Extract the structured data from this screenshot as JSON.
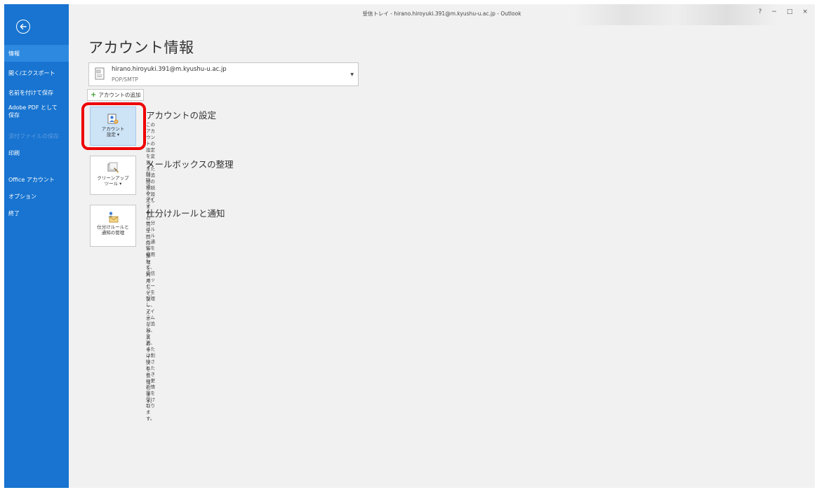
{
  "window": {
    "title": "受信トレイ - hirano.hiroyuki.391@m.kyushu-u.ac.jp - Outlook",
    "help": "?",
    "minimize": "−",
    "restore": "□",
    "close": "×"
  },
  "sidebar": {
    "back_icon": "back-arrow-icon",
    "items": [
      {
        "label": "情報"
      },
      {
        "label": "開く/エクスポート"
      },
      {
        "label": "名前を付けて保存"
      },
      {
        "label": "Adobe PDF として\n保存"
      },
      {
        "label": "添付ファイルの保存"
      },
      {
        "label": "印刷"
      },
      {
        "label": "Office アカウント"
      },
      {
        "label": "オプション"
      },
      {
        "label": "終了"
      }
    ],
    "colors": {
      "background": "#1874d0",
      "selected": "#2d89e0"
    }
  },
  "page": {
    "title": "アカウント情報"
  },
  "account": {
    "email": "hirano.hiroyuki.391@m.kyushu-u.ac.jp",
    "type": "POP/SMTP",
    "caret": "▼"
  },
  "add_account": {
    "label": "アカウントの追加"
  },
  "sections": [
    {
      "tile_label": "アカウント\n設定 ▾",
      "heading": "アカウントの設定",
      "description": "このアカウントの設定を変更、または追加の接続を設定します。"
    },
    {
      "tile_label": "クリーンアップ\nツール ▾",
      "heading": "メールボックスの整理",
      "description": "削除済みアイテムの完全削除や整理を利用して、メールボックスのサイズを管理します。"
    },
    {
      "tile_label": "仕分けルールと\n通知の管理",
      "heading": "仕分けルールと通知",
      "description": "仕分けルールと通知を使用して、受信メッセージを整理し、アイテムが追加、変更、または削\n除されたときに更新情報を受け取ります。"
    }
  ],
  "accent_colors": {
    "highlight_ring": "#ee0000",
    "content_bg": "#f1f1f1"
  }
}
